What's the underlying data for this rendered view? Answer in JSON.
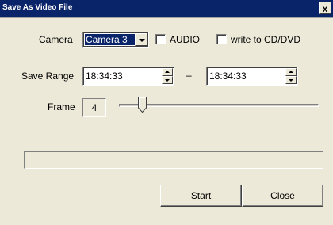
{
  "window": {
    "title": "Save As Video File",
    "close_glyph": "x"
  },
  "camera": {
    "label": "Camera",
    "selected": "Camera 3"
  },
  "options": {
    "audio_label": "AUDIO",
    "audio_checked": false,
    "cd_label": "write to CD/DVD",
    "cd_checked": false
  },
  "save_range": {
    "label": "Save Range",
    "start": "18:34:33",
    "separator": "–",
    "end": "18:34:33"
  },
  "frame": {
    "label": "Frame",
    "value": "4",
    "slider_level": 0.1
  },
  "progress": {
    "fraction": 0
  },
  "buttons": {
    "start": "Start",
    "close": "Close"
  }
}
